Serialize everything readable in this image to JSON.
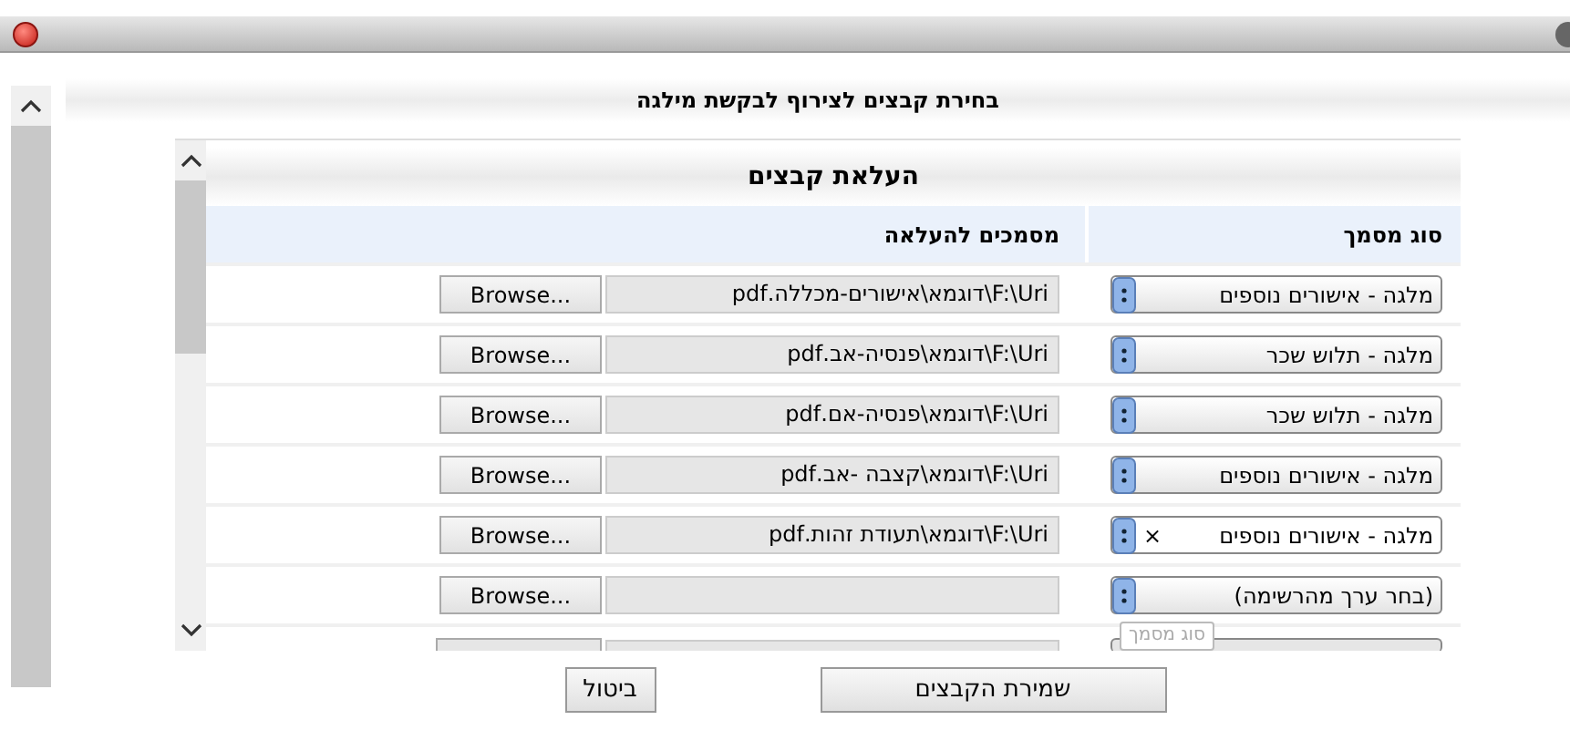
{
  "dialog": {
    "heading": "בחירת קבצים לצירוף לבקשת מילגה"
  },
  "panel": {
    "title": "העלאת קבצים"
  },
  "table": {
    "columns": [
      "סוג מסמך",
      "מסמכים להעלאה"
    ],
    "rows": [
      {
        "doc_type": "מלגה - אישורים נוספים",
        "file": "F:\\Uri\\דוגמא\\אישורים-מכללה.pdf",
        "browse": "Browse...",
        "clearable": false
      },
      {
        "doc_type": "מלגה - תלוש שכר",
        "file": "F:\\Uri\\דוגמא\\פנסיה-אב.pdf",
        "browse": "Browse...",
        "clearable": false
      },
      {
        "doc_type": "מלגה - תלוש שכר",
        "file": "F:\\Uri\\דוגמא\\פנסיה-אם.pdf",
        "browse": "Browse...",
        "clearable": false
      },
      {
        "doc_type": "מלגה - אישורים נוספים",
        "file": "F:\\Uri\\דוגמא\\קצבה -אב.pdf",
        "browse": "Browse...",
        "clearable": false
      },
      {
        "doc_type": "מלגה - אישורים נוספים",
        "file": "F:\\Uri\\דוגמא\\תעודת זהות.pdf",
        "browse": "Browse...",
        "clearable": true,
        "clear": "×"
      },
      {
        "doc_type": "(בחר ערך מהרשימה)",
        "browse": "Browse...",
        "clearable": false
      }
    ]
  },
  "tooltip": "סוג מסמך",
  "buttons": [
    {
      "label": "שמירת הקבצים",
      "kind": "primary"
    },
    {
      "label": "ביטול",
      "kind": "cancel"
    }
  ]
}
